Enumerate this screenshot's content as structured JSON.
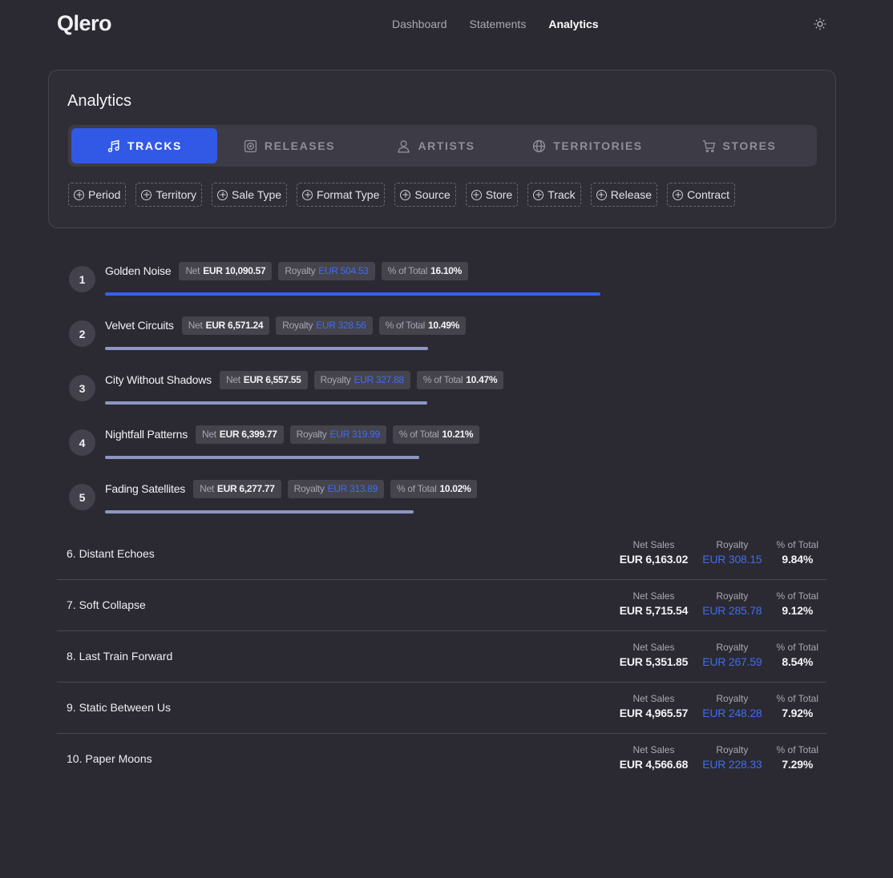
{
  "app": {
    "name": "Qlero"
  },
  "nav": {
    "items": [
      "Dashboard",
      "Statements",
      "Analytics"
    ],
    "active": "Analytics"
  },
  "analytics": {
    "title": "Analytics",
    "tabs": [
      "TRACKS",
      "RELEASES",
      "ARTISTS",
      "TERRITORIES",
      "STORES"
    ],
    "active_tab": "TRACKS",
    "filters": [
      "Period",
      "Territory",
      "Sale Type",
      "Format Type",
      "Source",
      "Store",
      "Track",
      "Release",
      "Contract"
    ]
  },
  "labels": {
    "net": "Net",
    "royalty": "Royalty",
    "pct": "% of Total",
    "net_sales": "Net Sales"
  },
  "top_tracks": [
    {
      "rank": "1",
      "name": "Golden Noise",
      "net": "EUR 10,090.57",
      "royalty": "EUR 504.53",
      "pct": "16.10%",
      "pct_value": 16.1
    },
    {
      "rank": "2",
      "name": "Velvet Circuits",
      "net": "EUR 6,571.24",
      "royalty": "EUR 328.56",
      "pct": "10.49%",
      "pct_value": 10.49
    },
    {
      "rank": "3",
      "name": "City Without Shadows",
      "net": "EUR 6,557.55",
      "royalty": "EUR 327.88",
      "pct": "10.47%",
      "pct_value": 10.47
    },
    {
      "rank": "4",
      "name": "Nightfall Patterns",
      "net": "EUR 6,399.77",
      "royalty": "EUR 319.99",
      "pct": "10.21%",
      "pct_value": 10.21
    },
    {
      "rank": "5",
      "name": "Fading Satellites",
      "net": "EUR 6,277.77",
      "royalty": "EUR 313.89",
      "pct": "10.02%",
      "pct_value": 10.02
    }
  ],
  "other_tracks": [
    {
      "name": "6.  Distant Echoes",
      "net": "EUR 6,163.02",
      "royalty": "EUR 308.15",
      "pct": "9.84%"
    },
    {
      "name": "7.  Soft Collapse",
      "net": "EUR 5,715.54",
      "royalty": "EUR 285.78",
      "pct": "9.12%"
    },
    {
      "name": "8.  Last Train Forward",
      "net": "EUR 5,351.85",
      "royalty": "EUR 267.59",
      "pct": "8.54%"
    },
    {
      "name": "9.  Static Between Us",
      "net": "EUR 4,965.57",
      "royalty": "EUR 248.28",
      "pct": "7.92%"
    },
    {
      "name": "10.  Paper Moons",
      "net": "EUR 4,566.68",
      "royalty": "EUR 228.33",
      "pct": "7.29%"
    }
  ],
  "colors": {
    "accent": "#3259e6",
    "royalty_text": "#3f6df0",
    "bar_first": "#3463ea",
    "bar_rest": "#8e97c2"
  },
  "icons": {
    "theme": "sun-icon",
    "tabs": [
      "music-note-icon",
      "record-icon",
      "user-icon",
      "globe-icon",
      "cart-icon"
    ]
  }
}
